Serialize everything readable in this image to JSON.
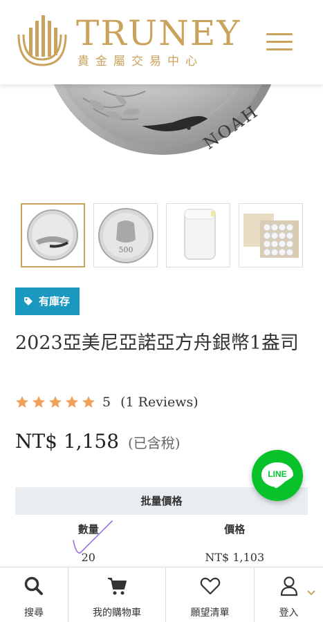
{
  "brand": {
    "name": "TRUNEY",
    "subtitle": "貴金屬交易中心",
    "color": "#c9a25b"
  },
  "header": {
    "menu_icon": "hamburger-menu-icon"
  },
  "main_image": {
    "coin_inscription": "NOAH"
  },
  "gallery": {
    "thumbnails": [
      {
        "name": "coin-reverse-thumbnail",
        "active": true
      },
      {
        "name": "coin-obverse-thumbnail",
        "active": false
      },
      {
        "name": "coin-tube-thumbnail",
        "active": false
      },
      {
        "name": "coin-box-thumbnail",
        "active": false
      }
    ]
  },
  "product": {
    "stock_badge": "有庫存",
    "stock_color": "#1a98bf",
    "title": "2023亞美尼亞諾亞方舟銀幣1盎司",
    "rating_stars": 5,
    "rating_value": "5",
    "rating_reviews": "(1 Reviews)",
    "star_color": "#f0a05a",
    "price": "NT$ 1,158",
    "tax_note": "(已含稅)"
  },
  "bulk_pricing": {
    "title": "批量價格",
    "columns": [
      "數量",
      "價格"
    ],
    "rows": [
      {
        "quantity": "20",
        "price": "NT$ 1,103"
      }
    ]
  },
  "floating": {
    "line_label": "LINE",
    "line_color": "#07c22b"
  },
  "bottom_nav": {
    "items": [
      {
        "label": "搜尋",
        "icon": "search-icon"
      },
      {
        "label": "我的購物車",
        "icon": "cart-icon"
      },
      {
        "label": "願望清單",
        "icon": "heart-icon"
      },
      {
        "label": "登入",
        "icon": "user-icon"
      }
    ]
  }
}
